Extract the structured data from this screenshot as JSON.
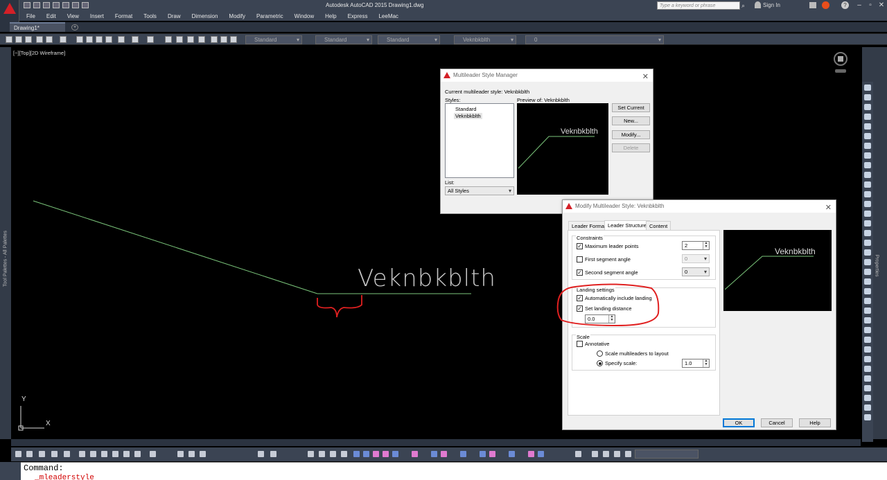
{
  "app": {
    "title": "Autodesk AutoCAD 2015    Drawing1.dwg",
    "search_placeholder": "Type a keyword or phrase",
    "sign_in": "Sign In",
    "accent": "#d42027"
  },
  "menu": [
    "File",
    "Edit",
    "View",
    "Insert",
    "Format",
    "Tools",
    "Draw",
    "Dimension",
    "Modify",
    "Parametric",
    "Window",
    "Help",
    "Express",
    "LeeMac"
  ],
  "tabs": {
    "active": "Drawing1*",
    "plus": "+"
  },
  "toolbar": {
    "text_style": "Standard",
    "dim_style": "Standard",
    "table_style": "Standard",
    "mleader_style": "Veknbkblth",
    "layer": "0"
  },
  "viewport": {
    "label": "[−][Top][2D Wireframe]",
    "drawing_text": "Veknbkblth",
    "ucs_x": "X",
    "ucs_y": "Y",
    "left_palette": "Tool Palettes - All Palettes",
    "right_palette": "Properties"
  },
  "command": {
    "line1": "Command:",
    "line2": "_mleaderstyle"
  },
  "style_manager": {
    "title": "Multileader Style Manager",
    "current_label": "Current multileader style: Veknbkblth",
    "styles_label": "Styles:",
    "styles": [
      "Standard",
      "Veknbkblth"
    ],
    "preview_label": "Preview of: Veknbkblth",
    "preview_text": "Veknbkblth",
    "list_label": "List:",
    "list_value": "All Styles",
    "btn_set_current": "Set Current",
    "btn_new": "New...",
    "btn_modify": "Modify...",
    "btn_delete": "Delete"
  },
  "modify_dialog": {
    "title": "Modify Multileader Style: Veknbkblth",
    "tabs": [
      "Leader Format",
      "Leader Structure",
      "Content"
    ],
    "constraints": {
      "title": "Constraints",
      "max_points_label": "Maximum leader points",
      "max_points_value": "2",
      "first_angle_label": "First segment angle",
      "first_angle_value": "0",
      "second_angle_label": "Second segment angle",
      "second_angle_value": "0"
    },
    "landing": {
      "title": "Landing settings",
      "auto_include_label": "Automatically include landing",
      "set_distance_label": "Set landing distance",
      "distance_value": "0.0"
    },
    "scale": {
      "title": "Scale",
      "annotative_label": "Annotative",
      "scale_to_layout_label": "Scale multileaders to layout",
      "specify_scale_label": "Specify scale:",
      "scale_value": "1.0"
    },
    "preview_text": "Veknbkblth",
    "btn_ok": "OK",
    "btn_cancel": "Cancel",
    "btn_help": "Help"
  }
}
